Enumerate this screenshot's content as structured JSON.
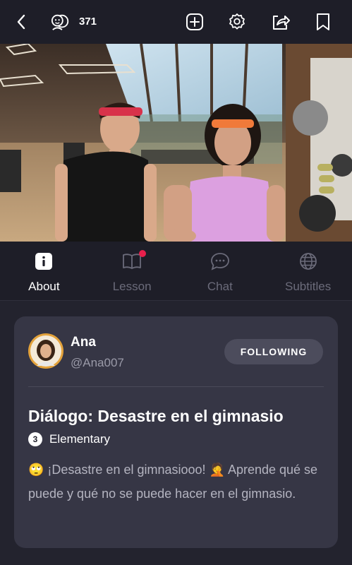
{
  "topbar": {
    "viewers_count": "371",
    "icons": [
      "back-icon",
      "viewers-icon",
      "add-icon",
      "settings-icon",
      "share-icon",
      "bookmark-icon"
    ]
  },
  "tabs": [
    {
      "label": "About",
      "icon": "info-icon",
      "active": true
    },
    {
      "label": "Lesson",
      "icon": "book-icon",
      "active": false,
      "has_notification": true
    },
    {
      "label": "Chat",
      "icon": "chat-icon",
      "active": false
    },
    {
      "label": "Subtitles",
      "icon": "globe-icon",
      "active": false
    }
  ],
  "author": {
    "name": "Ana",
    "handle": "@Ana007",
    "follow_label": "FOLLOWING"
  },
  "lesson": {
    "title": "Diálogo: Desastre en el gimnasio",
    "level_number": "3",
    "level_label": "Elementary",
    "description": "🙄 ¡Desastre en el gimnasiooo! 🤦 Aprende qué se puede y qué no se puede hacer en el gimnasio."
  },
  "colors": {
    "background": "#23232e",
    "card": "#363645",
    "notification": "#e8204c"
  }
}
